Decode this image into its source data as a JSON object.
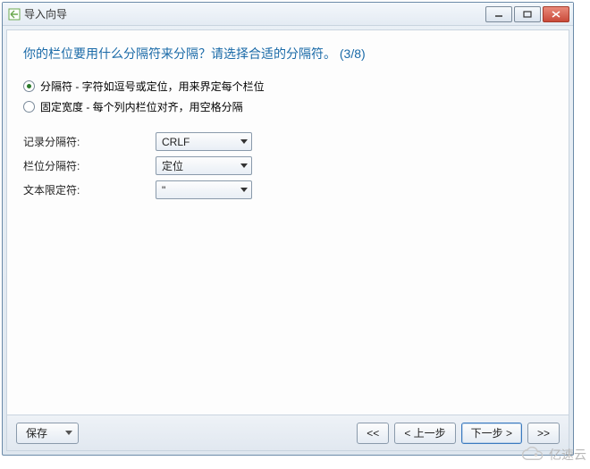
{
  "window": {
    "title": "导入向导"
  },
  "heading": "你的栏位要用什么分隔符来分隔？请选择合适的分隔符。 (3/8)",
  "options": {
    "delimiter": {
      "checked": true,
      "label": "分隔符 - 字符如逗号或定位，用来界定每个栏位"
    },
    "fixed": {
      "checked": false,
      "label": "固定宽度 - 每个列内栏位对齐，用空格分隔"
    }
  },
  "fields": {
    "record_sep": {
      "label": "记录分隔符:",
      "value": "CRLF"
    },
    "field_sep": {
      "label": "栏位分隔符:",
      "value": "定位"
    },
    "text_qual": {
      "label": "文本限定符:",
      "value": "\""
    }
  },
  "footer": {
    "save": "保存",
    "first": "<<",
    "prev": "< 上一步",
    "next": "下一步 >",
    "last": ">>"
  },
  "watermark": "亿速云"
}
